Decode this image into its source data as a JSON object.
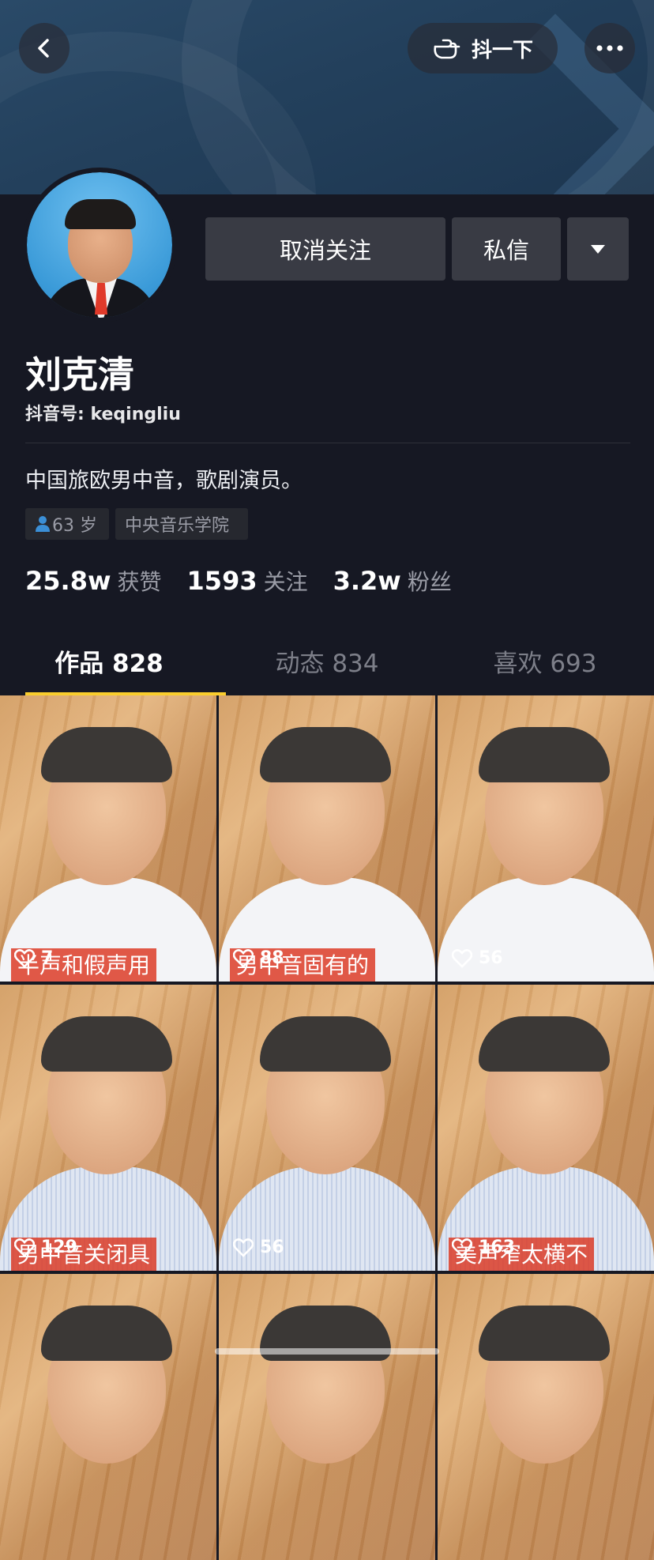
{
  "header": {
    "poke_label": "抖一下"
  },
  "profile": {
    "name": "刘克清",
    "douyin_id": "抖音号: keqingliu",
    "bio": "中国旅欧男中音，歌剧演员。",
    "age_tag": "63 岁",
    "school_tag": "中央音乐学院",
    "unfollow_label": "取消关注",
    "message_label": "私信"
  },
  "stats": [
    {
      "value": "25.8w",
      "label": "获赞"
    },
    {
      "value": "1593",
      "label": "关注"
    },
    {
      "value": "3.2w",
      "label": "粉丝"
    }
  ],
  "tabs": [
    {
      "label": "作品 828",
      "active": true
    },
    {
      "label": "动态 834",
      "active": false
    },
    {
      "label": "喜欢 693",
      "active": false
    }
  ],
  "videos": [
    {
      "likes": "7",
      "caption": "半声和假声用"
    },
    {
      "likes": "88",
      "caption": "男中音固有的"
    },
    {
      "likes": "56",
      "caption": ""
    },
    {
      "likes": "129",
      "caption": "男中音关闭具"
    },
    {
      "likes": "56",
      "caption": ""
    },
    {
      "likes": "163",
      "caption": "美声窄太横不"
    }
  ],
  "colors": {
    "background": "#161823",
    "accent": "#facd2d",
    "button": "#393b44"
  }
}
